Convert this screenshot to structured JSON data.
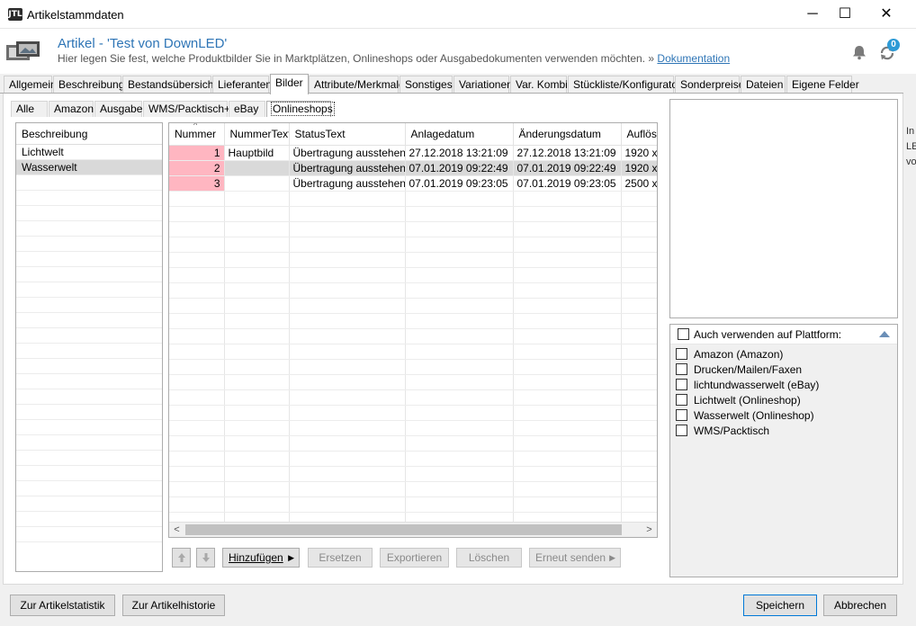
{
  "window": {
    "title": "Artikelstammdaten",
    "app_icon": "JTL",
    "minimize": "─",
    "maximize": "☐",
    "close": "✕"
  },
  "header": {
    "title": "Artikel - 'Test von DownLED'",
    "description": "Hier legen Sie fest, welche Produktbilder Sie in Marktplätzen, Onlineshops oder Ausgabedokumenten verwenden möchten.",
    "link_prefix": "»",
    "link_label": "Dokumentation",
    "badge_count": "0"
  },
  "main_tabs": [
    "Allgemein",
    "Beschreibung",
    "Bestandsübersicht",
    "Lieferanten",
    "Bilder",
    "Attribute/Merkmale",
    "Sonstiges",
    "Variationen",
    "Var. Kombi",
    "Stückliste/Konfigurator",
    "Sonderpreise",
    "Dateien",
    "Eigene Felder"
  ],
  "active_main_tab": "Bilder",
  "sub_tabs": [
    "Alle",
    "Amazon",
    "Ausgabe",
    "WMS/Packtisch+",
    "eBay",
    "Onlineshops"
  ],
  "active_sub_tab": "Onlineshops",
  "shop_list": {
    "header": "Beschreibung",
    "items": [
      "Lichtwelt",
      "Wasserwelt"
    ],
    "selected": "Wasserwelt"
  },
  "image_grid": {
    "columns": [
      "Nummer",
      "NummerText",
      "StatusText",
      "Anlagedatum",
      "Änderungsdatum",
      "Auflösu"
    ],
    "rows": [
      {
        "nummer": "1",
        "nummertext": "Hauptbild",
        "status": "Übertragung ausstehend",
        "anlage": "27.12.2018 13:21:09",
        "aenderung": "27.12.2018 13:21:09",
        "aufloesung": "1920 x"
      },
      {
        "nummer": "2",
        "nummertext": "",
        "status": "Übertragung ausstehend",
        "anlage": "07.01.2019 09:22:49",
        "aenderung": "07.01.2019 09:22:49",
        "aufloesung": "1920 x"
      },
      {
        "nummer": "3",
        "nummertext": "",
        "status": "Übertragung ausstehend",
        "anlage": "07.01.2019 09:23:05",
        "aenderung": "07.01.2019 09:23:05",
        "aufloesung": "2500 x"
      }
    ],
    "selected_row": 1
  },
  "grid_buttons": {
    "hinzufuegen": "Hinzufügen",
    "ersetzen": "Ersetzen",
    "exportieren": "Exportieren",
    "loeschen": "Löschen",
    "erneut_senden": "Erneut senden"
  },
  "platform_panel": {
    "header": "Auch verwenden auf Plattform:",
    "items": [
      "Amazon (Amazon)",
      "Drucken/Mailen/Faxen",
      "lichtundwasserwelt (eBay)",
      "Lichtwelt (Onlineshop)",
      "Wasserwelt (Onlineshop)",
      "WMS/Packtisch"
    ]
  },
  "bottom_buttons": {
    "statistik": "Zur Artikelstatistik",
    "historie": "Zur Artikelhistorie",
    "speichern": "Speichern",
    "abbrechen": "Abbrechen"
  },
  "edge_text": [
    "In",
    "LE",
    "vo"
  ]
}
